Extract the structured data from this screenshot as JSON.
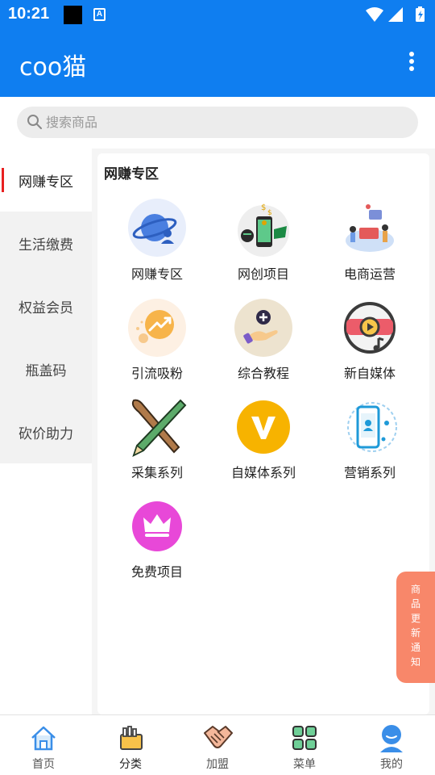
{
  "status": {
    "time": "10:21",
    "a_icon": "A"
  },
  "app": {
    "title": "coo猫"
  },
  "search": {
    "placeholder": "搜索商品"
  },
  "sidebar": {
    "items": [
      {
        "label": "网赚专区"
      },
      {
        "label": "生活缴费"
      },
      {
        "label": "权益会员"
      },
      {
        "label": "瓶盖码"
      },
      {
        "label": "砍价助力"
      }
    ]
  },
  "panel": {
    "title": "网赚专区",
    "items": [
      {
        "label": "网赚专区",
        "icon": "planet-user-icon"
      },
      {
        "label": "网创项目",
        "icon": "phone-money-icon"
      },
      {
        "label": "电商运营",
        "icon": "ecommerce-team-icon"
      },
      {
        "label": "引流吸粉",
        "icon": "growth-chart-icon"
      },
      {
        "label": "综合教程",
        "icon": "hand-plus-icon"
      },
      {
        "label": "新自媒体",
        "icon": "video-play-icon"
      },
      {
        "label": "采集系列",
        "icon": "brush-pencil-icon"
      },
      {
        "label": "自媒体系列",
        "icon": "v-badge-icon"
      },
      {
        "label": "营销系列",
        "icon": "phone-marketing-icon"
      },
      {
        "label": "免费项目",
        "icon": "crown-icon"
      }
    ]
  },
  "notify": {
    "chars": [
      "商",
      "品",
      "更",
      "新",
      "通",
      "知"
    ]
  },
  "tabbar": {
    "items": [
      {
        "label": "首页",
        "icon": "home-icon"
      },
      {
        "label": "分类",
        "icon": "category-icon"
      },
      {
        "label": "加盟",
        "icon": "handshake-icon"
      },
      {
        "label": "菜单",
        "icon": "grid-menu-icon"
      },
      {
        "label": "我的",
        "icon": "user-icon"
      }
    ]
  },
  "colors": {
    "primary": "#0f7ef0",
    "active_bar": "#e82020",
    "notify_bg": "#f8876a"
  }
}
